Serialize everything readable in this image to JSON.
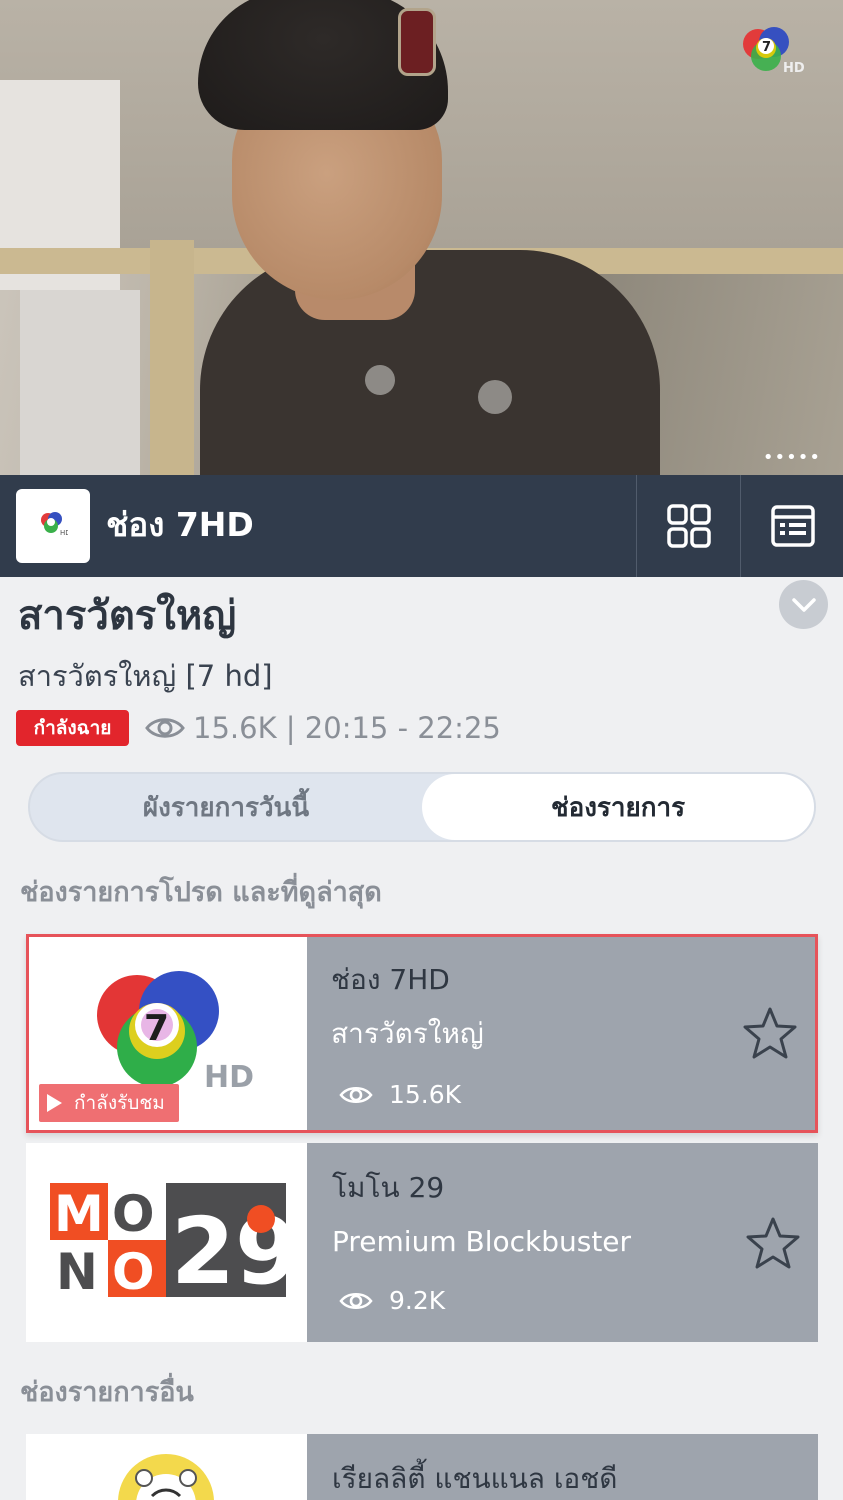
{
  "video": {
    "more_label": "•••••",
    "channel_watermark": "7 HD"
  },
  "channel_bar": {
    "channel_name": "ช่อง 7HD",
    "grid_icon": "grid-icon",
    "guide_icon": "program-guide-icon"
  },
  "program": {
    "title": "สารวัตรใหญ่",
    "subtitle": "สารวัตรใหญ่ [7 hd]",
    "live_label": "กำลังฉาย",
    "views_time": "15.6K | 20:15 - 22:25"
  },
  "tabs": {
    "today_label": "ผังรายการวันนี้",
    "channels_label": "ช่องรายการ",
    "active": "channels"
  },
  "sections": {
    "favorites_label": "ช่องรายการโปรด และที่ดูล่าสุด",
    "others_label": "ช่องรายการอื่น"
  },
  "cards": [
    {
      "channel": "ช่อง 7HD",
      "program": "สารวัตรใหญ่",
      "views": "15.6K",
      "watching_label": "กำลังรับชม",
      "logo_text": "HD",
      "active": true
    },
    {
      "channel": "โมโน 29",
      "program": "Premium Blockbuster",
      "views": "9.2K",
      "logo_letters": [
        "M",
        "O",
        "N",
        "O"
      ],
      "logo_number": "29",
      "active": false
    },
    {
      "channel": "เรียลลิตี้ แชนแนล เอชดี",
      "active": false
    }
  ],
  "colors": {
    "accent_red": "#e2252c",
    "bar_dark": "#313c4c",
    "card_grey": "#9ea4ad",
    "mono_orange": "#f04e23"
  }
}
